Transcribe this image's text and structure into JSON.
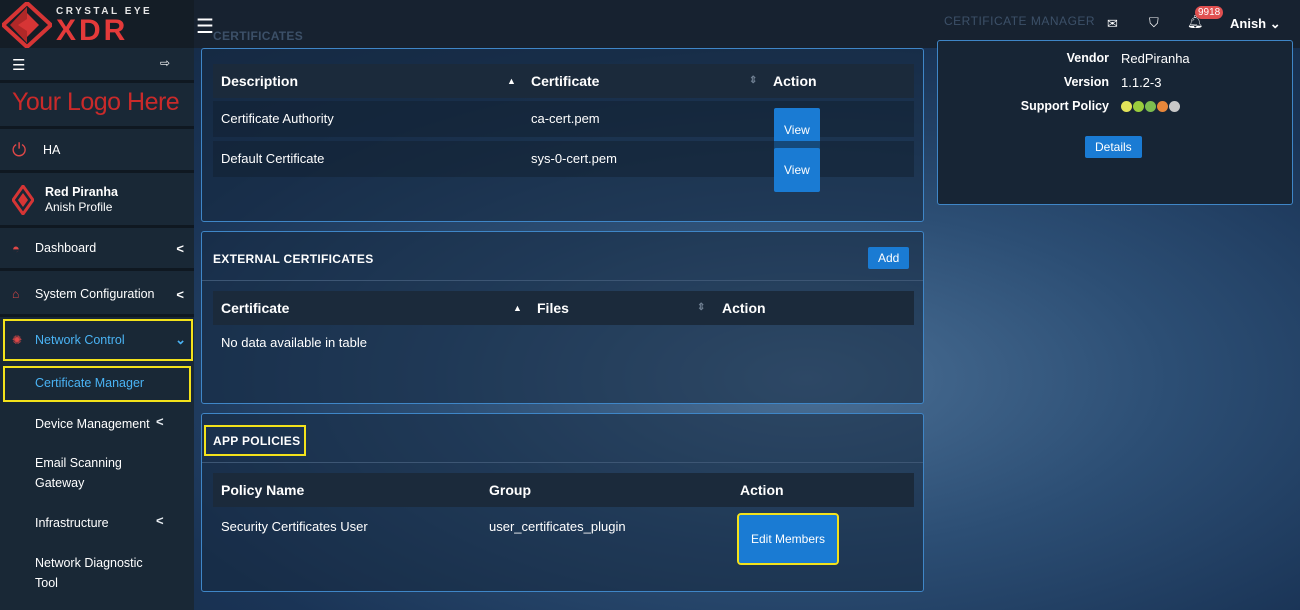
{
  "brand": {
    "tagline": "CRYSTAL EYE",
    "name": "XDR"
  },
  "sidebar": {
    "logo_text": "Your Logo Here",
    "ha_label": "HA",
    "profile": {
      "name": "Red Piranha",
      "subtitle": "Anish Profile"
    },
    "items": [
      {
        "label": "Dashboard"
      },
      {
        "label": "System Configuration"
      },
      {
        "label": "Network Control"
      }
    ],
    "subitems": [
      {
        "label": "Certificate Manager"
      },
      {
        "label": "Device Management"
      },
      {
        "label": "Email Scanning Gateway"
      },
      {
        "label": "Infrastructure"
      },
      {
        "label": "Network Diagnostic Tool"
      }
    ]
  },
  "topbar": {
    "faint_title": "CERTIFICATE MANAGER",
    "notifications": "9918",
    "user": "Anish"
  },
  "certificates_panel": {
    "title": "CERTIFICATES",
    "columns": [
      "Description",
      "Certificate",
      "Action"
    ],
    "rows": [
      {
        "description": "Certificate Authority",
        "certificate": "ca-cert.pem",
        "action": "View"
      },
      {
        "description": "Default Certificate",
        "certificate": "sys-0-cert.pem",
        "action": "View"
      }
    ]
  },
  "external_panel": {
    "title": "EXTERNAL CERTIFICATES",
    "add_label": "Add",
    "columns": [
      "Certificate",
      "Files",
      "Action"
    ],
    "empty": "No data available in table"
  },
  "policies_panel": {
    "title": "APP POLICIES",
    "columns": [
      "Policy Name",
      "Group",
      "Action"
    ],
    "rows": [
      {
        "name": "Security Certificates User",
        "group": "user_certificates_plugin",
        "action": "Edit Members"
      }
    ]
  },
  "info_panel": {
    "vendor_label": "Vendor",
    "vendor": "RedPiranha",
    "version_label": "Version",
    "version": "1.1.2-3",
    "support_label": "Support Policy",
    "support_dots": [
      "#e3e35a",
      "#9acd3c",
      "#7dbd4f",
      "#e8873a",
      "#c8c8c8"
    ],
    "details_label": "Details"
  },
  "colors": {
    "accent": "#1a7bd3",
    "highlight": "#f3e21b",
    "brand_red": "#e43a3a"
  }
}
